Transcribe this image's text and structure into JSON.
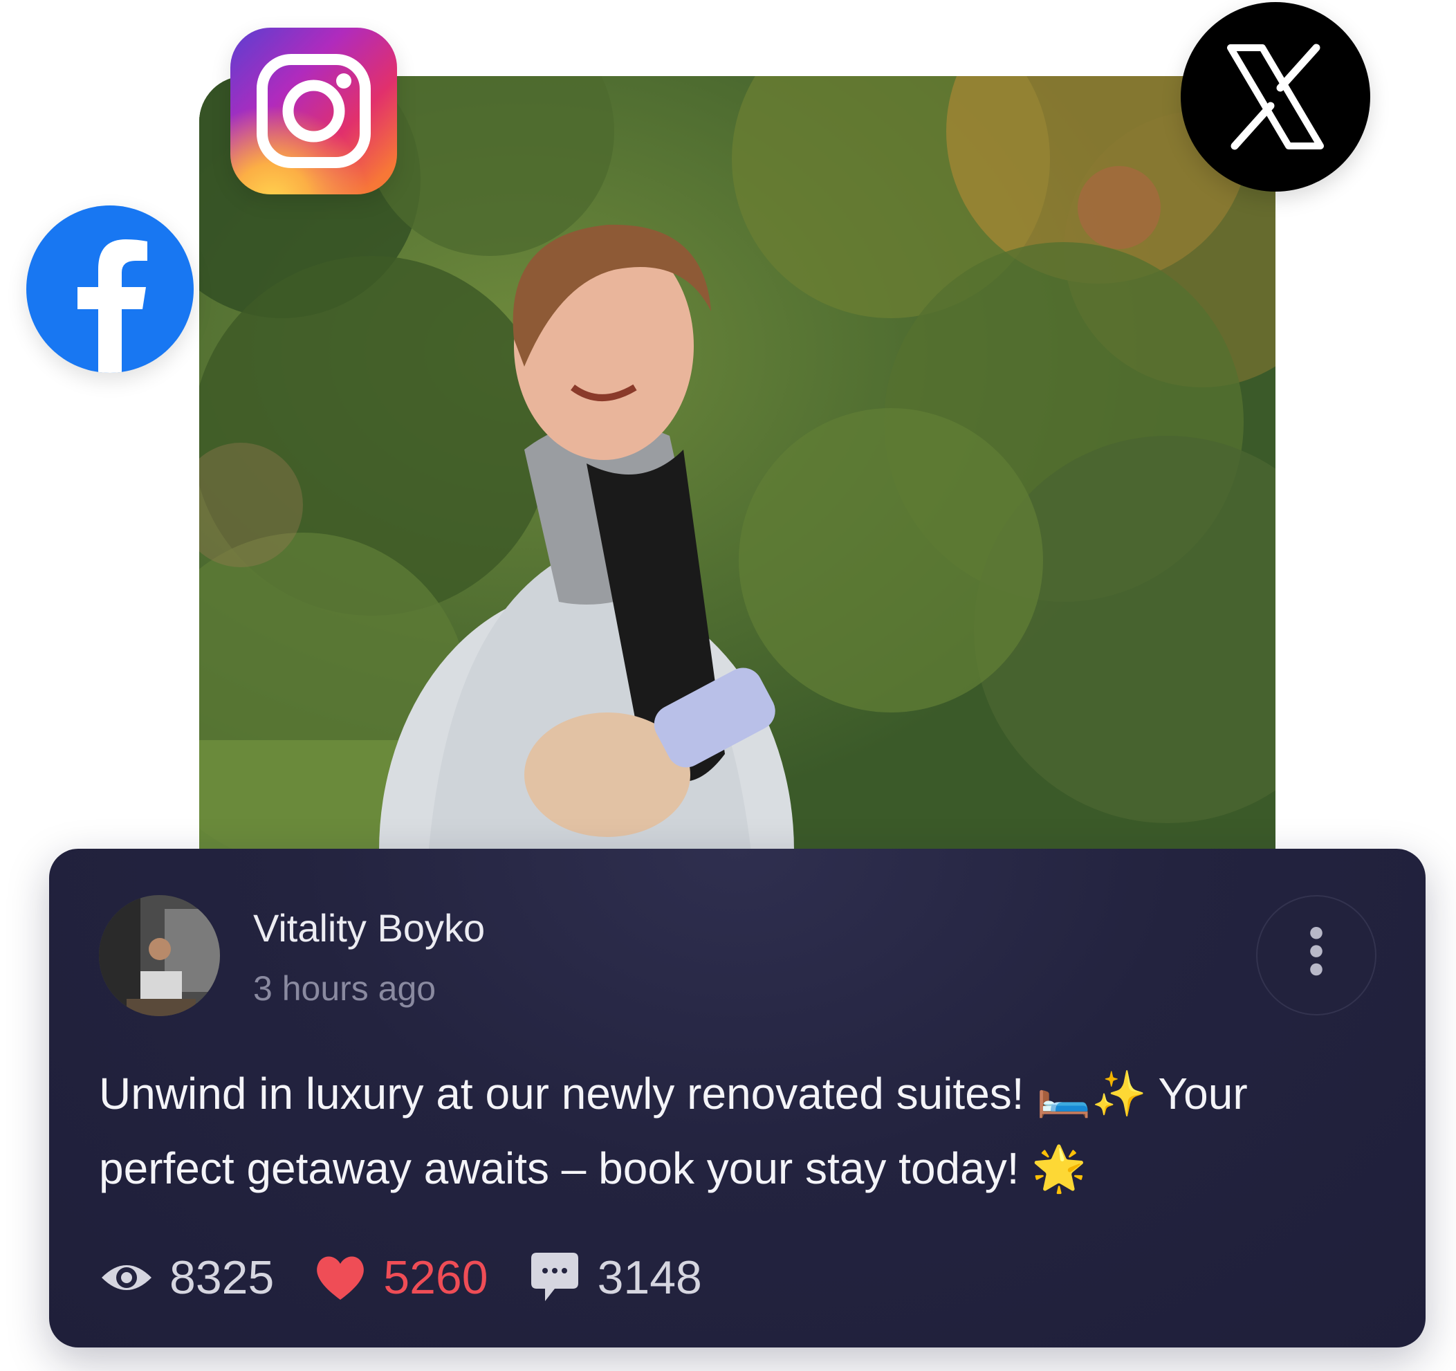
{
  "post": {
    "author_name": "Vitality Boyko",
    "time": "3 hours ago",
    "text": "Unwind in luxury at our newly renovated suites! 🛏️✨ Your perfect getaway awaits – book your stay today! 🌟"
  },
  "stats": {
    "views": "8325",
    "likes": "5260",
    "comments": "3148"
  },
  "icons": {
    "instagram": "instagram-icon",
    "facebook": "facebook-icon",
    "x": "x-icon",
    "more": "more-vertical-icon",
    "views": "eye-icon",
    "likes": "heart-icon",
    "comments": "comment-bubble-icon"
  },
  "colors": {
    "card_background": "#23233f",
    "likes_accent": "#ef4d56",
    "facebook_blue": "#1877f2",
    "secondary_text": "#8a8aa0"
  }
}
